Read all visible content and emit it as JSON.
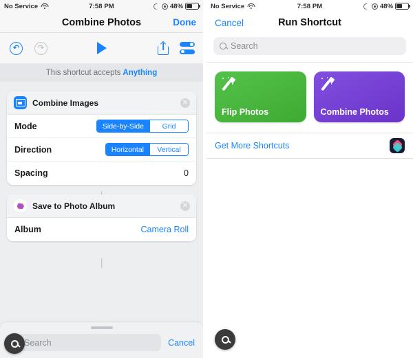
{
  "status_bar": {
    "carrier": "No Service",
    "wifi_icon": "wifi-icon",
    "time": "7:58 PM",
    "dnd_icon": "moon-icon",
    "rotation_lock_icon": "rotation-lock-icon",
    "battery_percent": "48%",
    "battery_level": 48
  },
  "left_screen": {
    "nav": {
      "title": "Combine Photos",
      "done_label": "Done"
    },
    "toolbar": {
      "undo_icon": "undo-icon",
      "redo_icon": "redo-icon",
      "play_icon": "play-icon",
      "share_icon": "share-icon",
      "settings_icon": "sliders-icon"
    },
    "accepts": {
      "prefix": "This shortcut accepts",
      "type": "Anything"
    },
    "actions": [
      {
        "icon": "combine-images-icon",
        "title": "Combine Images",
        "close_icon": "close-icon",
        "rows": [
          {
            "label": "Mode",
            "type": "segmented",
            "options": [
              "Side-by-Side",
              "Grid"
            ],
            "selected": "Side-by-Side"
          },
          {
            "label": "Direction",
            "type": "segmented",
            "options": [
              "Horizontal",
              "Vertical"
            ],
            "selected": "Horizontal"
          },
          {
            "label": "Spacing",
            "type": "value",
            "value": "0"
          }
        ]
      },
      {
        "icon": "photos-app-icon",
        "title": "Save to Photo Album",
        "close_icon": "close-icon",
        "rows": [
          {
            "label": "Album",
            "type": "link",
            "value": "Camera Roll"
          }
        ]
      }
    ],
    "bottom_sheet": {
      "grabber": "sheet-grabber",
      "search_placeholder": "Search",
      "search_value": "",
      "search_icon": "search-icon",
      "cancel_label": "Cancel"
    },
    "zoom_cursor_icon": "magnifier-cursor-icon"
  },
  "right_screen": {
    "nav": {
      "cancel_label": "Cancel",
      "title": "Run Shortcut"
    },
    "search": {
      "placeholder": "Search",
      "value": "",
      "icon": "search-icon"
    },
    "tiles": [
      {
        "label": "Flip Photos",
        "color": "#45b23c",
        "icon": "magic-wand-icon"
      },
      {
        "label": "Combine Photos",
        "color": "#7240d4",
        "icon": "magic-wand-icon"
      }
    ],
    "get_more": {
      "label": "Get More Shortcuts",
      "icon": "shortcuts-app-icon"
    },
    "zoom_cursor_icon": "magnifier-cursor-icon"
  },
  "colors": {
    "accent_blue": "#1a84ff",
    "tile_green": "#45b23c",
    "tile_purple": "#7240d4",
    "background_grey": "#eceef0"
  }
}
